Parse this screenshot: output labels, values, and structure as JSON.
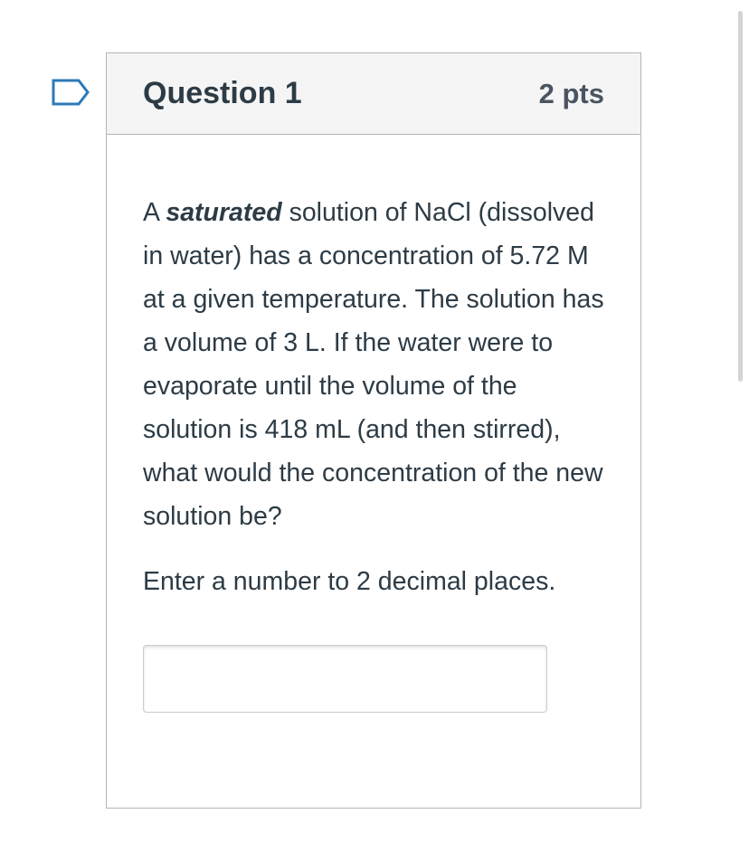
{
  "flag_icon": "bookmark-flag-icon",
  "question": {
    "title": "Question 1",
    "points": "2 pts",
    "text_before_emphasis": "A ",
    "emphasis": "saturated",
    "text_after_emphasis": " solution of NaCl (dissolved in water) has a concentration of 5.72 M at a given temperature. The solution has a volume of 3 L. If the water were to evaporate until the volume of the solution is 418 mL (and then stirred), what would the concentration of the new solution be?",
    "instruction": "Enter a number to 2 decimal places.",
    "answer": {
      "value": "",
      "placeholder": ""
    }
  },
  "colors": {
    "text": "#2d3b45",
    "header_bg": "#f5f5f5",
    "border": "#b5b5b5",
    "flag": "#2d7ab8"
  }
}
